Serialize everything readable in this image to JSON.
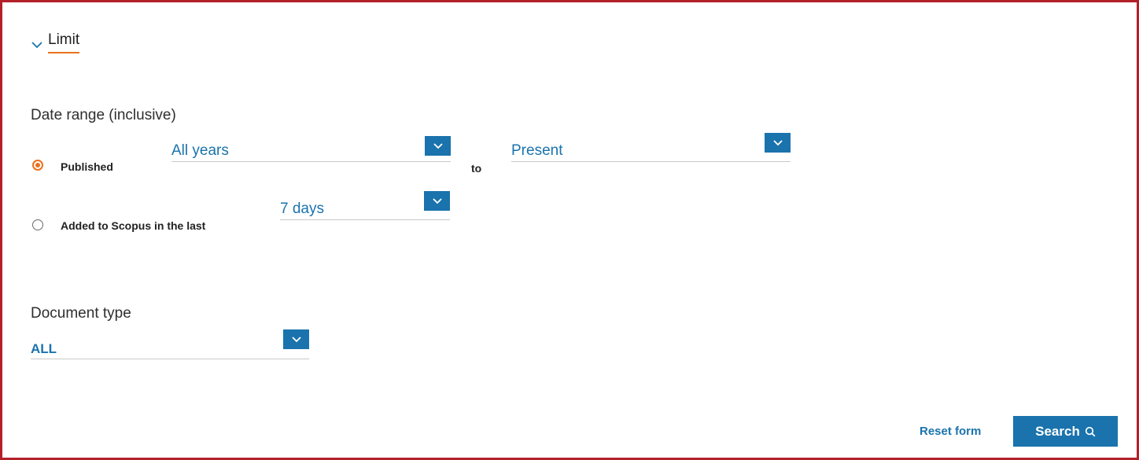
{
  "limit": {
    "label": "Limit",
    "icon": "chevron-down-icon"
  },
  "date_range": {
    "heading": "Date range (inclusive)",
    "options": [
      {
        "label": "Published",
        "selected": true
      },
      {
        "label": "Added to Scopus in the last",
        "selected": false
      }
    ],
    "from_value": "All years",
    "to_label": "to",
    "to_value": "Present",
    "added_value": "7 days"
  },
  "document_type": {
    "heading": "Document type",
    "value": "ALL"
  },
  "actions": {
    "reset_label": "Reset form",
    "search_label": "Search",
    "search_icon": "search-icon"
  },
  "colors": {
    "accent": "#1a73ad",
    "selected_radio": "#e9711c",
    "frame_border": "#b3202a"
  }
}
